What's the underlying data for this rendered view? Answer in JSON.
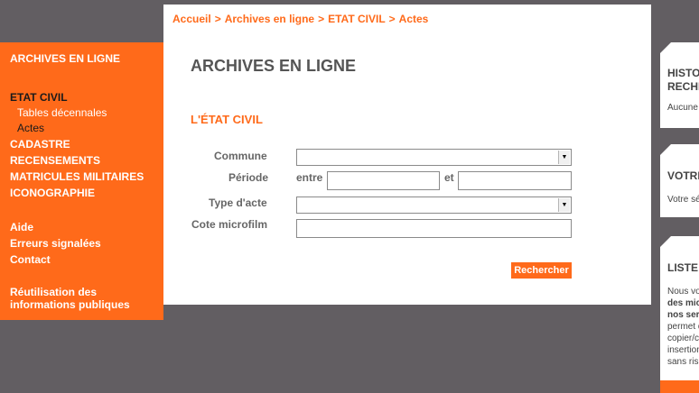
{
  "sidebar": {
    "title": "ARCHIVES EN LIGNE",
    "etat_civil": "ETAT CIVIL",
    "sub_items": [
      "Tables décennales",
      "Actes"
    ],
    "items": [
      "CADASTRE",
      "RECENSEMENTS",
      "MATRICULES MILITAIRES",
      "ICONOGRAPHIE"
    ],
    "help_items": [
      "Aide",
      "Erreurs signalées",
      "Contact"
    ],
    "reuse_line1": "Réutilisation des",
    "reuse_line2": "informations publiques"
  },
  "breadcrumb": [
    "Accueil",
    "Archives en ligne",
    "ETAT CIVIL",
    "Actes"
  ],
  "breadcrumb_sep": ">",
  "main": {
    "title": "ARCHIVES EN LIGNE",
    "section": "L'ÉTAT CIVIL"
  },
  "form": {
    "commune_label": "Commune",
    "periode_label": "Période",
    "entre_label": "entre",
    "et_label": "et",
    "type_label": "Type d'acte",
    "cote_label": "Cote microfilm",
    "submit": "Rechercher"
  },
  "right": {
    "panel1_title_1": "HISTO",
    "panel1_title_2": "RECHE",
    "panel1_text": "Aucune",
    "panel2_title": "VOTRE",
    "panel2_text": "Votre sé",
    "panel3_title": "LISTE",
    "panel3_lines": [
      "Nous vo",
      "des mic",
      "nos ser",
      "permet d",
      "copier/c",
      "insertion",
      "sans ris"
    ]
  },
  "colors": {
    "accent": "#ff6a1a",
    "background": "#625e62"
  }
}
